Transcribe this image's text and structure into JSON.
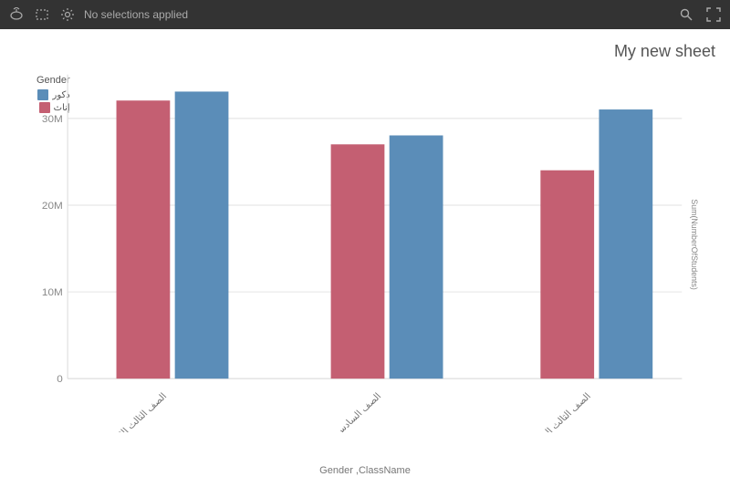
{
  "toolbar": {
    "status": "No selections applied",
    "icons": [
      "lasso-icon",
      "rectangle-select-icon",
      "settings-icon",
      "search-icon",
      "fullscreen-icon"
    ]
  },
  "sheet": {
    "title": "My new sheet"
  },
  "chart": {
    "title": "Gender",
    "legend": [
      {
        "label": "ذكور",
        "color": "#5b8db8"
      },
      {
        "label": "إناث",
        "color": "#c45f72"
      }
    ],
    "yAxisLabel": "Sum(NumberOfStudents)",
    "xAxisLabel": "Gender ,ClassName",
    "yTicks": [
      "0",
      "10M",
      "20M",
      "30M"
    ],
    "groups": [
      {
        "label": "الصف الثالث الابتدائي",
        "bars": [
          {
            "gender": "إناث",
            "value": 32000000,
            "color": "#c45f72"
          },
          {
            "gender": "ذكور",
            "value": 33000000,
            "color": "#5b8db8"
          }
        ]
      },
      {
        "label": "الصف السادس الابتدائي",
        "bars": [
          {
            "gender": "إناث",
            "value": 27000000,
            "color": "#c45f72"
          },
          {
            "gender": "ذكور",
            "value": 28000000,
            "color": "#5b8db8"
          }
        ]
      },
      {
        "label": "الصف الثالث المتوسط",
        "bars": [
          {
            "gender": "إناث",
            "value": 24000000,
            "color": "#c45f72"
          },
          {
            "gender": "ذكور",
            "value": 31000000,
            "color": "#5b8db8"
          }
        ]
      }
    ]
  }
}
